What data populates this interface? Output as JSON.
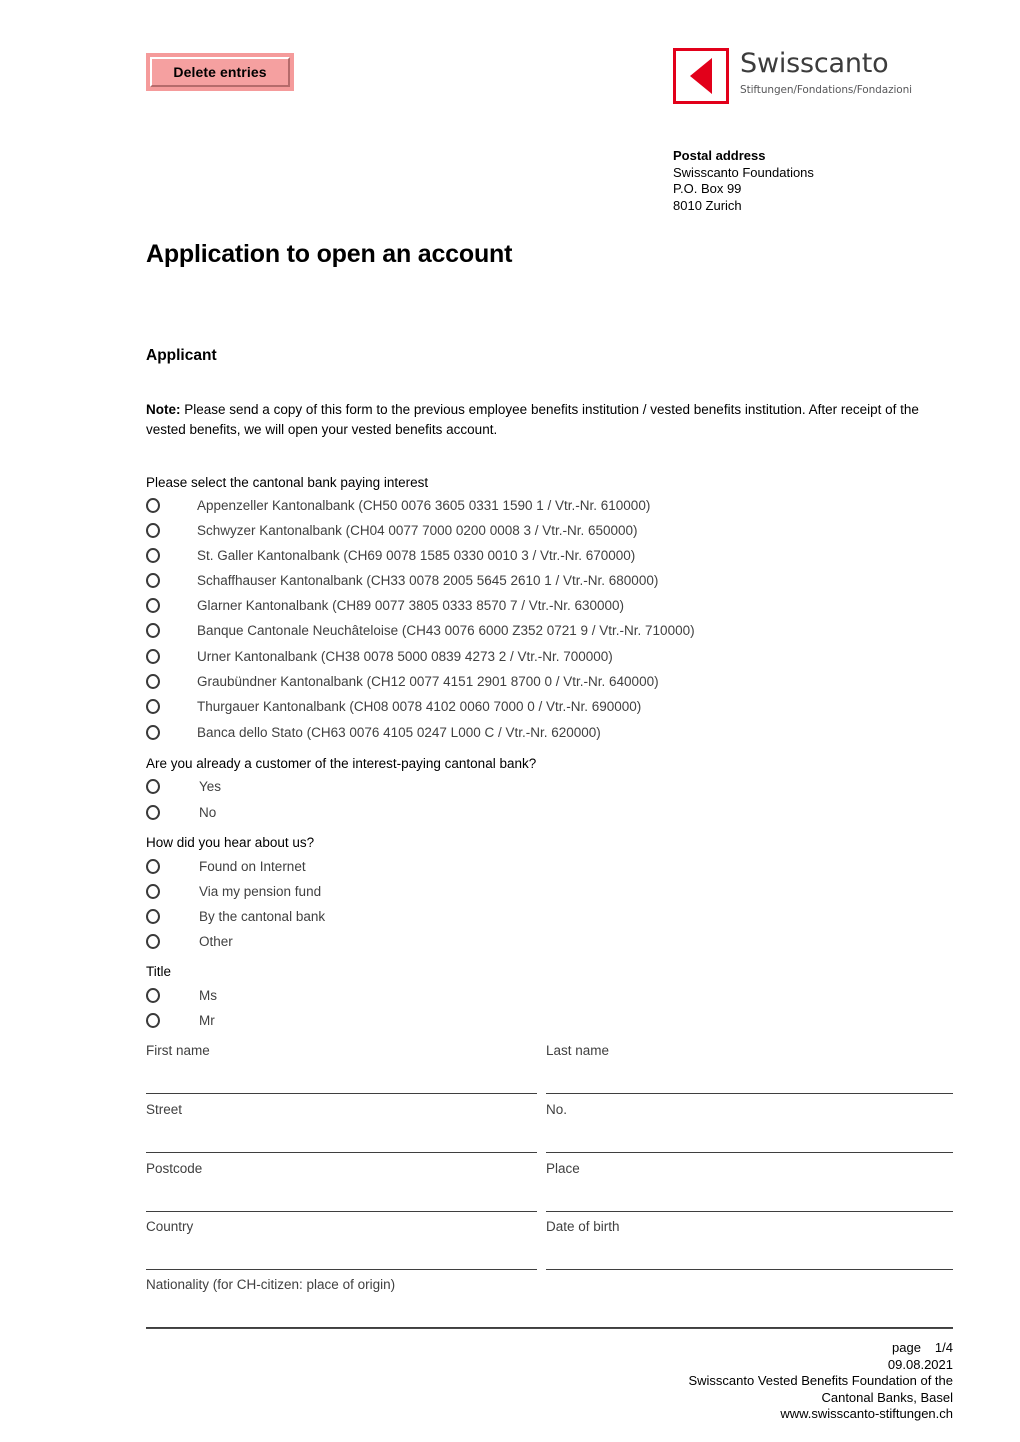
{
  "toolbar": {
    "delete_entries_label": "Delete entries"
  },
  "brand": {
    "name": "Swisscanto",
    "tagline": "Stiftungen/Fondations/Fondazioni",
    "accent_color": "#e2001a"
  },
  "postal_address": {
    "heading": "Postal address",
    "line1": "Swisscanto Foundations",
    "line2": "P.O. Box 99",
    "line3": "8010 Zurich"
  },
  "document": {
    "title": "Application to open an account",
    "section_heading": "Applicant",
    "note_label": "Note:",
    "note_text": " Please send a copy of this form to the previous employee benefits institution / vested benefits institution. After receipt of the vested benefits, we will open your vested benefits account."
  },
  "bank_selection": {
    "question": "Please select the cantonal bank paying interest",
    "options": [
      "Appenzeller Kantonalbank (CH50 0076 3605 0331 1590 1 / Vtr.-Nr. 610000)",
      "Schwyzer Kantonalbank (CH04 0077 7000 0200 0008 3 / Vtr.-Nr. 650000)",
      "St. Galler Kantonalbank (CH69 0078 1585 0330 0010 3 / Vtr.-Nr. 670000)",
      "Schaffhauser Kantonalbank (CH33 0078 2005 5645 2610 1 / Vtr.-Nr. 680000)",
      "Glarner Kantonalbank (CH89 0077 3805 0333 8570 7 / Vtr.-Nr. 630000)",
      "Banque Cantonale Neuchâteloise (CH43 0076 6000 Z352 0721 9 / Vtr.-Nr. 710000)",
      "Urner Kantonalbank (CH38 0078 5000 0839 4273 2 / Vtr.-Nr. 700000)",
      "Graubündner Kantonalbank (CH12 0077 4151 2901 8700 0 / Vtr.-Nr. 640000)",
      "Thurgauer Kantonalbank (CH08 0078 4102 0060 7000 0 / Vtr.-Nr. 690000)",
      "Banca dello Stato (CH63 0076 4105 0247 L000 C / Vtr.-Nr. 620000)"
    ]
  },
  "existing_customer": {
    "question": "Are you already a customer of the interest-paying cantonal bank?",
    "options": [
      "Yes",
      "No"
    ]
  },
  "referral": {
    "question": "How did you hear about us?",
    "options": [
      "Found on Internet",
      "Via my pension fund",
      "By the cantonal bank",
      "Other"
    ]
  },
  "title_field": {
    "question": "Title",
    "options": [
      "Ms",
      "Mr"
    ]
  },
  "personal_fields": {
    "first_name": {
      "label": "First name",
      "value": ""
    },
    "last_name": {
      "label": "Last name",
      "value": ""
    },
    "street": {
      "label": "Street",
      "value": ""
    },
    "number": {
      "label": "No.",
      "value": ""
    },
    "postcode": {
      "label": "Postcode",
      "value": ""
    },
    "place": {
      "label": "Place",
      "value": ""
    },
    "country": {
      "label": "Country",
      "value": ""
    },
    "date_of_birth": {
      "label": "Date of birth",
      "value": ""
    },
    "nationality": {
      "label": "Nationality (for CH-citizen: place of origin)",
      "value": ""
    }
  },
  "footer": {
    "page_label": "page",
    "page_number": "1/4",
    "date": "09.08.2021",
    "org_line1": "Swisscanto Vested Benefits Foundation of the",
    "org_line2": "Cantonal Banks, Basel",
    "website": "www.swisscanto-stiftungen.ch"
  }
}
